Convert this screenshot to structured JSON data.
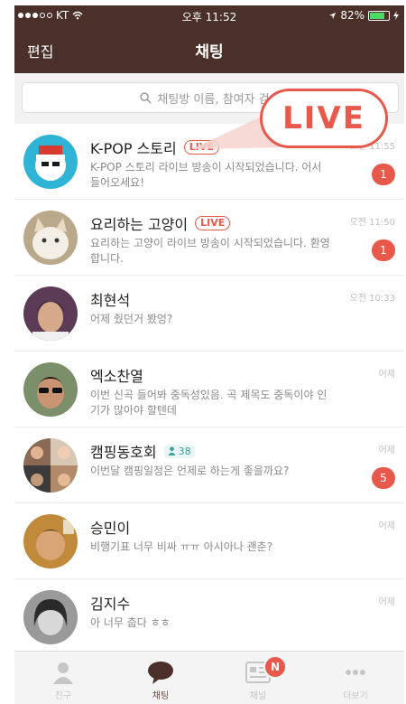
{
  "status_bar": {
    "carrier": "KT",
    "time": "오후 11:52",
    "battery": "82%",
    "battery_level": 0.82
  },
  "header": {
    "edit_label": "편집",
    "title": "채팅"
  },
  "search": {
    "placeholder": "채팅방 이름, 참여자 검색"
  },
  "callout": {
    "text": "LIVE"
  },
  "chats": [
    {
      "name": "K-POP 스토리",
      "badge": "LIVE",
      "preview": "K-POP 스토리 라이브 방송이 시작되었습니다. 어서 들어오세요!",
      "time": "오전 11:55",
      "unread": "1"
    },
    {
      "name": "요리하는 고양이",
      "badge": "LIVE",
      "preview": "요리하는 고양이 라이브 방송이 시작되었습니다. 환영합니다.",
      "time": "오전 11:50",
      "unread": "1"
    },
    {
      "name": "최현석",
      "preview": "어제 줬던거 봤엉?",
      "time": "오전 10:33"
    },
    {
      "name": "엑소찬열",
      "preview": "이번 신곡 들어봐 중독성있음. 곡 제목도 중독이야 인기가 많아야 할텐데",
      "time": "어제"
    },
    {
      "name": "캠핑동호회",
      "members": "38",
      "preview": "이번달 캠핑일정은 언제로 하는게 좋을까요?",
      "time": "어제",
      "unread": "5"
    },
    {
      "name": "승민이",
      "preview": "비행기표 너무 비싸 ㅠㅠ 아시아나 괜춘?",
      "time": "어제"
    },
    {
      "name": "김지수",
      "preview": "아 너무 춥다 ㅎㅎ",
      "time": "어제"
    }
  ],
  "tabs": [
    {
      "label": "친구",
      "icon": "person-icon"
    },
    {
      "label": "채팅",
      "icon": "chat-bubble-icon",
      "active": true
    },
    {
      "label": "채널",
      "icon": "channel-icon",
      "badge": "N"
    },
    {
      "label": "더보기",
      "icon": "more-icon"
    }
  ],
  "colors": {
    "brand": "#4b302a",
    "accent": "#e8584b",
    "members": "#3ba19b"
  }
}
